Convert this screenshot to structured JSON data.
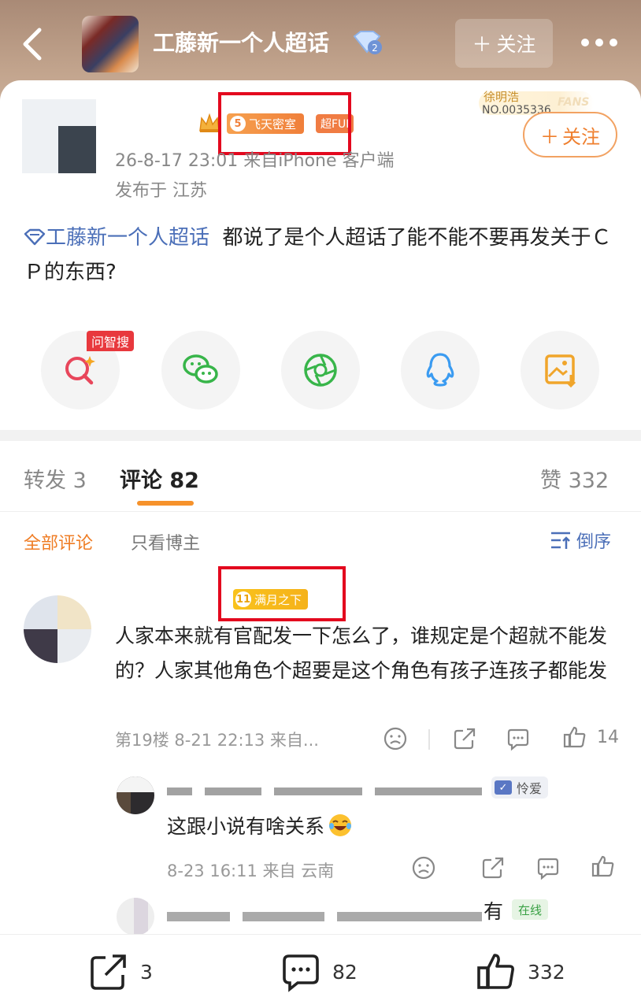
{
  "header": {
    "topic_title": "工藤新一个人超话",
    "follow_label": "关注",
    "diamond_level": "2"
  },
  "post": {
    "crown_badge_number": "5",
    "group_badge": "飞天密室",
    "fan_badge": "超FUI",
    "fans_card": {
      "name": "徐明浩",
      "number": "NO.0035336",
      "watermark": "FANS"
    },
    "follow_label": "关注",
    "meta": "26-8-17 23:01  来自iPhone 客户端",
    "location": "发布于 江苏",
    "topic_link": "工藤新一个人超话",
    "text": "都说了是个人超话了能不能不要再发关于ＣＰ的东西?"
  },
  "share": {
    "ai_tag": "问智搜",
    "buttons": [
      "ai-search",
      "wechat",
      "moments",
      "qq",
      "save-image"
    ]
  },
  "tabs": {
    "repost": "转发 3",
    "comment": "评论 82",
    "like": "赞 332"
  },
  "filters": {
    "all": "全部评论",
    "poster_only": "只看博主",
    "sort": "倒序"
  },
  "comment1": {
    "badge_number": "11",
    "badge_label": "满月之下",
    "text": "人家本来就有官配发一下怎么了，谁规定是个超就不能发的？人家其他角色个超要是这个角色有孩子连孩子都能发",
    "meta": "第19楼 8-21 22:13 来自...",
    "likes": "14"
  },
  "reply1": {
    "badge": "怜爱",
    "text": "这跟小说有啥关系",
    "meta": "8-23 16:11 来自 云南"
  },
  "reply2": {
    "tail": "有",
    "status": "在线"
  },
  "bottom": {
    "reposts": "3",
    "comments": "82",
    "likes": "332"
  },
  "colors": {
    "accent_orange": "#ef7d25",
    "link_blue": "#4b6fb8",
    "highlight_red": "#e3081e"
  }
}
